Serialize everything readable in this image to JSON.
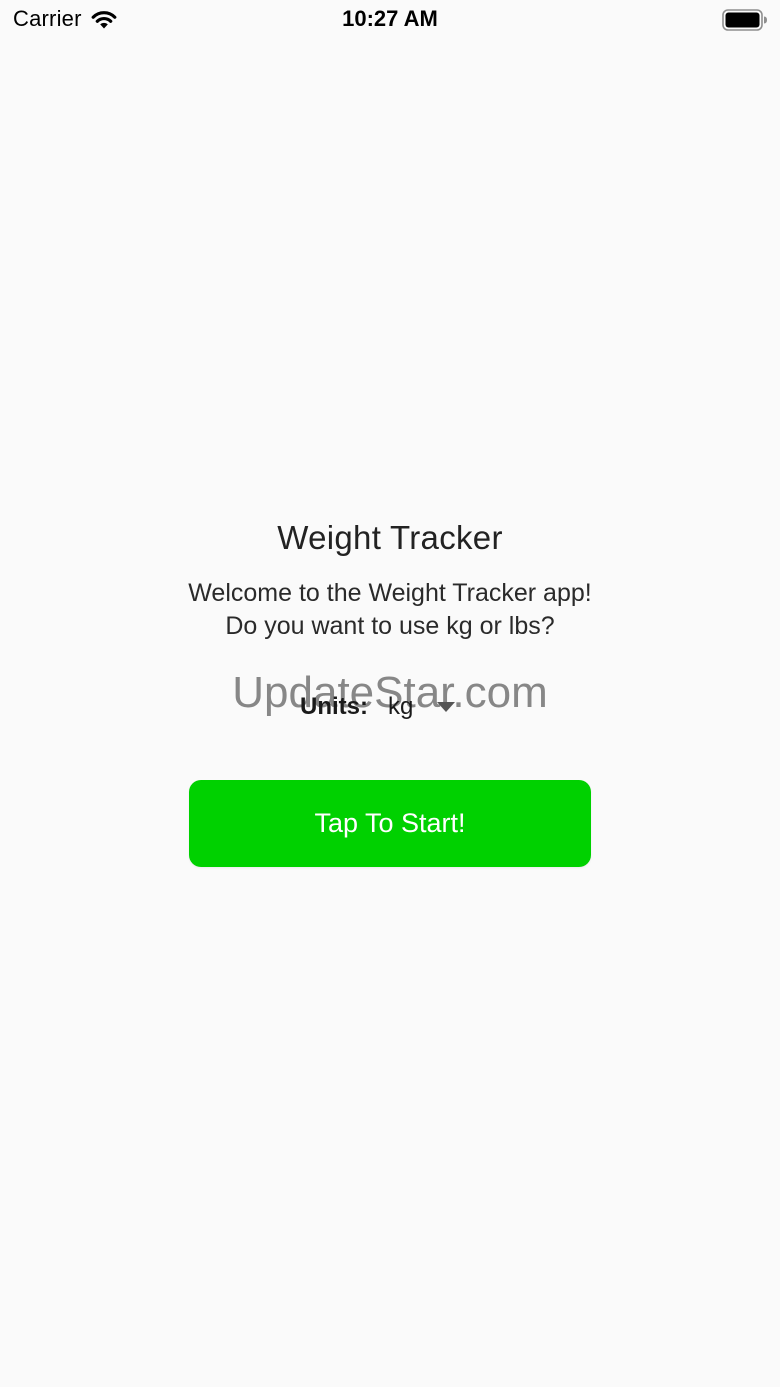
{
  "status_bar": {
    "carrier": "Carrier",
    "time": "10:27 AM",
    "icons": [
      "wifi-icon",
      "battery-icon"
    ]
  },
  "main": {
    "title": "Weight Tracker",
    "welcome_line1": "Welcome to the Weight Tracker app!",
    "welcome_line2": "Do you want to use kg or lbs?",
    "units_label": "Units:",
    "units_selected": "kg",
    "start_button_label": "Tap To Start!"
  },
  "watermark": "UpdateStar.com",
  "colors": {
    "background": "#fafafa",
    "start_button": "#00d100",
    "start_button_text": "#ffffff"
  }
}
